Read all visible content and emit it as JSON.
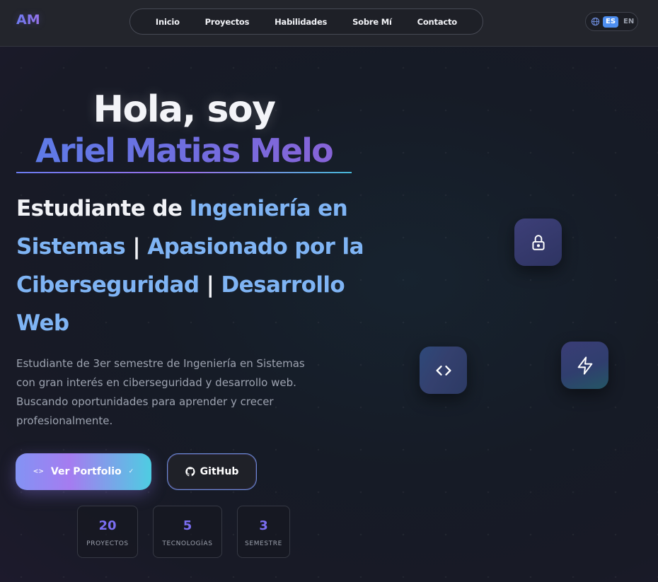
{
  "header": {
    "logo": "AM",
    "nav": [
      "Inicio",
      "Proyectos",
      "Habilidades",
      "Sobre Mí",
      "Contacto"
    ],
    "lang": {
      "active": "ES",
      "inactive": "EN"
    }
  },
  "hero": {
    "greeting": "Hola, soy",
    "name": "Ariel Matias Melo",
    "subtitle": [
      {
        "text": "Estudiante de ",
        "highlight": false
      },
      {
        "text": "Ingeniería en Sistemas",
        "highlight": true
      },
      {
        "text": " | ",
        "highlight": false
      },
      {
        "text": "Apasionado por la Ciberseguridad",
        "highlight": true
      },
      {
        "text": " | ",
        "highlight": false
      },
      {
        "text": "Desarrollo Web",
        "highlight": true
      }
    ],
    "description": "Estudiante de 3er semestre de Ingeniería en Sistemas con gran interés en ciberseguridad y desarrollo web. Buscando oportunidades para aprender y crecer profesionalmente.",
    "buttons": {
      "primary": "Ver Portfolio",
      "github": "GitHub"
    },
    "stats": [
      {
        "value": "20",
        "label": "PROYECTOS"
      },
      {
        "value": "5",
        "label": "TECNOLOGÍAS"
      },
      {
        "value": "3",
        "label": "SEMESTRE"
      }
    ]
  },
  "floating_icons": [
    "lock-icon",
    "code-icon",
    "bolt-icon"
  ],
  "colors": {
    "accent_purple": "#7b6ef2",
    "accent_blue": "#7fb4f4",
    "lang_active": "#4d8ef0"
  }
}
